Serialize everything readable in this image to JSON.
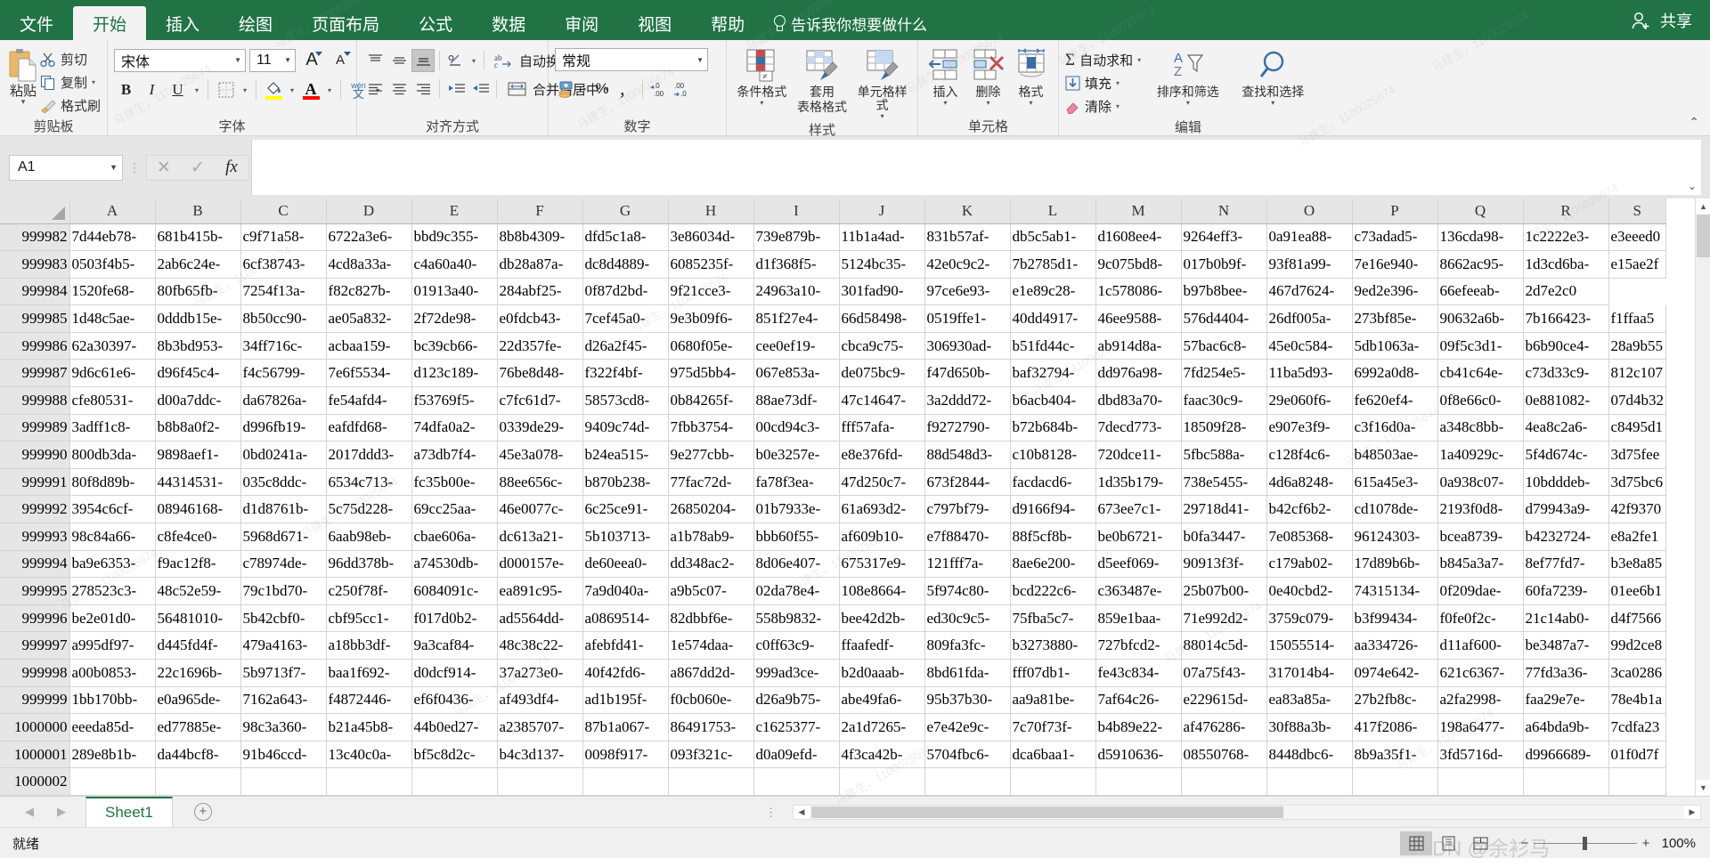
{
  "titlebar": {
    "tabs": [
      {
        "label": "文件",
        "active": false
      },
      {
        "label": "开始",
        "active": true
      },
      {
        "label": "插入",
        "active": false
      },
      {
        "label": "绘图",
        "active": false
      },
      {
        "label": "页面布局",
        "active": false
      },
      {
        "label": "公式",
        "active": false
      },
      {
        "label": "数据",
        "active": false
      },
      {
        "label": "审阅",
        "active": false
      },
      {
        "label": "视图",
        "active": false
      },
      {
        "label": "帮助",
        "active": false
      }
    ],
    "tell_me": "告诉我你想要做什么",
    "share": "共享"
  },
  "ribbon": {
    "clipboard": {
      "group_label": "剪贴板",
      "paste": "粘贴",
      "cut": "剪切",
      "copy": "复制",
      "format_painter": "格式刷"
    },
    "font": {
      "group_label": "字体",
      "font_name": "宋体",
      "font_size": "11",
      "bold": "B",
      "italic": "I",
      "underline": "U",
      "grow_font": "A",
      "shrink_font": "A",
      "phonetic": "wén 文"
    },
    "alignment": {
      "group_label": "对齐方式",
      "wrap_text": "自动换行",
      "merge_center": "合并后居中"
    },
    "number": {
      "group_label": "数字",
      "format": "常规",
      "percent": "%",
      "comma": "，"
    },
    "styles": {
      "group_label": "样式",
      "conditional": "条件格式",
      "table_style_line1": "套用",
      "table_style_line2": "表格格式",
      "cell_style": "单元格样式"
    },
    "cells": {
      "group_label": "单元格",
      "insert": "插入",
      "delete": "删除",
      "format": "格式"
    },
    "editing": {
      "group_label": "编辑",
      "autosum": "自动求和",
      "fill": "填充",
      "clear": "清除",
      "sort_filter": "排序和筛选",
      "find_select": "查找和选择"
    }
  },
  "formula_bar": {
    "name_box": "A1",
    "cancel_icon": "cancel-icon",
    "confirm_icon": "confirm-icon",
    "fx": "fx",
    "value": ""
  },
  "grid": {
    "columns": [
      "A",
      "B",
      "C",
      "D",
      "E",
      "F",
      "G",
      "H",
      "I",
      "J",
      "K",
      "L",
      "M",
      "N",
      "O",
      "P",
      "Q",
      "R",
      "S"
    ],
    "rows": [
      {
        "num": "999982",
        "cells": [
          "7d44eb78-",
          "681b415b-",
          "c9f71a58-",
          "6722a3e6-",
          "bbd9c355-",
          "8b8b4309-",
          "dfd5c1a8-",
          "3e86034d-",
          "739e879b-",
          "11b1a4ad-",
          "831b57af-",
          "db5c5ab1-",
          "d1608ee4-",
          "9264eff3-",
          "0a91ea88-",
          "c73adad5-",
          "136cda98-",
          "1c2222e3-",
          "e3eeed0"
        ]
      },
      {
        "num": "999983",
        "cells": [
          "0503f4b5-",
          "2ab6c24e-",
          "6cf38743-",
          "4cd8a33a-",
          "c4a60a40-",
          "db28a87a-",
          "dc8d4889-",
          "6085235f-",
          "d1f368f5-",
          "5124bc35-",
          "42e0c9c2-",
          "7b2785d1-",
          "9c075bd8-",
          "017b0b9f-",
          "93f81a99-",
          "7e16e940-",
          "8662ac95-",
          "1d3cd6ba-",
          "e15ae2f"
        ]
      },
      {
        "num": "999984",
        "cells": [
          "1520fe68-",
          "80fb65fb-",
          "7254f13a-",
          "f82c827b-",
          "01913a40-",
          "284abf25-",
          "0f87d2bd-",
          "9f21cce3-",
          "24963a10-",
          "301fad90-",
          "97ce6e93-",
          "e1e89c28-",
          "1c578086-",
          "b97b8bee-",
          "467d7624-",
          "9ed2e396-",
          "66efeeab-",
          "2d7e2c0"
        ]
      },
      {
        "num": "999985",
        "cells": [
          "1d48c5ae-",
          "0dddb15e-",
          "8b50cc90-",
          "ae05a832-",
          "2f72de98-",
          "e0fdcb43-",
          "7cef45a0-",
          "9e3b09f6-",
          "851f27e4-",
          "66d58498-",
          "0519ffe1-",
          "40dd4917-",
          "46ee9588-",
          "576d4404-",
          "26df005a-",
          "273bf85e-",
          "90632a6b-",
          "7b166423-",
          "f1ffaa5"
        ]
      },
      {
        "num": "999986",
        "cells": [
          "62a30397-",
          "8b3bd953-",
          "34ff716c-",
          "acbaa159-",
          "bc39cb66-",
          "22d357fe-",
          "d26a2f45-",
          "0680f05e-",
          "cee0ef19-",
          "cbca9c75-",
          "306930ad-",
          "b51fd44c-",
          "ab914d8a-",
          "57bac6c8-",
          "45e0c584-",
          "5db1063a-",
          "09f5c3d1-",
          "b6b90ce4-",
          "28a9b55"
        ]
      },
      {
        "num": "999987",
        "cells": [
          "9d6c61e6-",
          "d96f45c4-",
          "f4c56799-",
          "7e6f5534-",
          "d123c189-",
          "76be8d48-",
          "f322f4bf-",
          "975d5bb4-",
          "067e853a-",
          "de075bc9-",
          "f47d650b-",
          "baf32794-",
          "dd976a98-",
          "7fd254e5-",
          "11ba5d93-",
          "6992a0d8-",
          "cb41c64e-",
          "c73d33c9-",
          "812c107"
        ]
      },
      {
        "num": "999988",
        "cells": [
          "cfe80531-",
          "d00a7ddc-",
          "da67826a-",
          "fe54afd4-",
          "f53769f5-",
          "c7fc61d7-",
          "58573cd8-",
          "0b84265f-",
          "88ae73df-",
          "47c14647-",
          "3a2ddd72-",
          "b6acb404-",
          "dbd83a70-",
          "faac30c9-",
          "29e060f6-",
          "fe620ef4-",
          "0f8e66c0-",
          "0e881082-",
          "07d4b32"
        ]
      },
      {
        "num": "999989",
        "cells": [
          "3adff1c8-",
          "b8b8a0f2-",
          "d996fb19-",
          "eafdfd68-",
          "74dfa0a2-",
          "0339de29-",
          "9409c74d-",
          "7fbb3754-",
          "00cd94c3-",
          "fff57afa-",
          "f9272790-",
          "b72b684b-",
          "7decd773-",
          "18509f28-",
          "e907e3f9-",
          "c3f16d0a-",
          "a348c8bb-",
          "4ea8c2a6-",
          "c8495d1"
        ]
      },
      {
        "num": "999990",
        "cells": [
          "800db3da-",
          "9898aef1-",
          "0bd0241a-",
          "2017ddd3-",
          "a73db7f4-",
          "45e3a078-",
          "b24ea515-",
          "9e277cbb-",
          "b0e3257e-",
          "e8e376fd-",
          "88d548d3-",
          "c10b8128-",
          "720dce11-",
          "5fbc588a-",
          "c128f4c6-",
          "b48503ae-",
          "1a40929c-",
          "5f4d674c-",
          "3d75fee"
        ]
      },
      {
        "num": "999991",
        "cells": [
          "80f8d89b-",
          "44314531-",
          "035c8ddc-",
          "6534c713-",
          "fc35b00e-",
          "88ee656c-",
          "b870b238-",
          "77fac72d-",
          "fa78f3ea-",
          "47d250c7-",
          "673f2844-",
          "facdacd6-",
          "1d35b179-",
          "738e5455-",
          "4d6a8248-",
          "615a45e3-",
          "0a938c07-",
          "10bdddeb-",
          "3d75bc6"
        ]
      },
      {
        "num": "999992",
        "cells": [
          "3954c6cf-",
          "08946168-",
          "d1d8761b-",
          "5c75d228-",
          "69cc25aa-",
          "46e0077c-",
          "6c25ce91-",
          "26850204-",
          "01b7933e-",
          "61a693d2-",
          "c797bf79-",
          "d9166f94-",
          "673ee7c1-",
          "29718d41-",
          "b42cf6b2-",
          "cd1078de-",
          "2193f0d8-",
          "d79943a9-",
          "42f9370"
        ]
      },
      {
        "num": "999993",
        "cells": [
          "98c84a66-",
          "c8fe4ce0-",
          "5968d671-",
          "6aab98eb-",
          "cbae606a-",
          "dc613a21-",
          "5b103713-",
          "a1b78ab9-",
          "bbb60f55-",
          "af609b10-",
          "e7f88470-",
          "88f5cf8b-",
          "be0b6721-",
          "b0fa3447-",
          "7e085368-",
          "96124303-",
          "bcea8739-",
          "b4232724-",
          "e8a2fe1"
        ]
      },
      {
        "num": "999994",
        "cells": [
          "ba9e6353-",
          "f9ac12f8-",
          "c78974de-",
          "96dd378b-",
          "a74530db-",
          "d000157e-",
          "de60eea0-",
          "dd348ac2-",
          "8d06e407-",
          "675317e9-",
          "121fff7a-",
          "8ae6e200-",
          "d5eef069-",
          "90913f3f-",
          "c179ab02-",
          "17d89b6b-",
          "b845a3a7-",
          "8ef77fd7-",
          "b3e8a85"
        ]
      },
      {
        "num": "999995",
        "cells": [
          "278523c3-",
          "48c52e59-",
          "79c1bd70-",
          "c250f78f-",
          "6084091c-",
          "ea891c95-",
          "7a9d040a-",
          "a9b5c07-",
          "02da78e4-",
          "108e8664-",
          "5f974c80-",
          "bcd222c6-",
          "c363487e-",
          "25b07b00-",
          "0e40cbd2-",
          "74315134-",
          "0f209dae-",
          "60fa7239-",
          "01ee6b1"
        ]
      },
      {
        "num": "999996",
        "cells": [
          "be2e01d0-",
          "56481010-",
          "5b42cbf0-",
          "cbf95cc1-",
          "f017d0b2-",
          "ad5564dd-",
          "a0869514-",
          "82dbbf6e-",
          "558b9832-",
          "bee42d2b-",
          "ed30c9c5-",
          "75fba5c7-",
          "859e1baa-",
          "71e992d2-",
          "3759c079-",
          "b3f99434-",
          "f0fe0f2c-",
          "21c14ab0-",
          "d4f7566"
        ]
      },
      {
        "num": "999997",
        "cells": [
          "a995df97-",
          "d445fd4f-",
          "479a4163-",
          "a18bb3df-",
          "9a3caf84-",
          "48c38c22-",
          "afebfd41-",
          "1e574daa-",
          "c0ff63c9-",
          "ffaafedf-",
          "809fa3fc-",
          "b3273880-",
          "727bfcd2-",
          "88014c5d-",
          "15055514-",
          "aa334726-",
          "d11af600-",
          "be3487a7-",
          "99d2ce8"
        ]
      },
      {
        "num": "999998",
        "cells": [
          "a00b0853-",
          "22c1696b-",
          "5b9713f7-",
          "baa1f692-",
          "d0dcf914-",
          "37a273e0-",
          "40f42fd6-",
          "a867dd2d-",
          "999ad3ce-",
          "b2d0aaab-",
          "8bd61fda-",
          "fff07db1-",
          "fe43c834-",
          "07a75f43-",
          "317014b4-",
          "0974e642-",
          "621c6367-",
          "77fd3a36-",
          "3ca0286"
        ]
      },
      {
        "num": "999999",
        "cells": [
          "1bb170bb-",
          "e0a965de-",
          "7162a643-",
          "f4872446-",
          "ef6f0436-",
          "af493df4-",
          "ad1b195f-",
          "f0cb060e-",
          "d26a9b75-",
          "abe49fa6-",
          "95b37b30-",
          "aa9a81be-",
          "7af64c26-",
          "e229615d-",
          "ea83a85a-",
          "27b2fb8c-",
          "a2fa2998-",
          "faa29e7e-",
          "78e4b1a"
        ]
      },
      {
        "num": "1000000",
        "cells": [
          "eeeda85d-",
          "ed77885e-",
          "98c3a360-",
          "b21a45b8-",
          "44b0ed27-",
          "a2385707-",
          "87b1a067-",
          "86491753-",
          "c1625377-",
          "2a1d7265-",
          "e7e42e9c-",
          "7c70f73f-",
          "b4b89e22-",
          "af476286-",
          "30f88a3b-",
          "417f2086-",
          "198a6477-",
          "a64bda9b-",
          "7cdfa23"
        ]
      },
      {
        "num": "1000001",
        "cells": [
          "289e8b1b-",
          "da44bcf8-",
          "91b46ccd-",
          "13c40c0a-",
          "bf5c8d2c-",
          "b4c3d137-",
          "0098f917-",
          "093f321c-",
          "d0a09efd-",
          "4f3ca42b-",
          "5704fbc6-",
          "dca6baa1-",
          "d5910636-",
          "08550768-",
          "8448dbc6-",
          "8b9a35f1-",
          "3fd5716d-",
          "d9966689-",
          "01f0d7f"
        ]
      },
      {
        "num": "1000002",
        "cells": [
          "",
          "",
          "",
          "",
          "",
          "",
          "",
          "",
          "",
          "",
          "",
          "",
          "",
          "",
          "",
          "",
          "",
          "",
          ""
        ]
      }
    ]
  },
  "sheetbar": {
    "sheet_name": "Sheet1",
    "add_sheet_icon": "plus-icon"
  },
  "statusbar": {
    "status": "就绪",
    "zoom": "100%",
    "views": [
      "normal-view-icon",
      "page-layout-icon",
      "page-break-icon"
    ],
    "watermark": "CSDN @余衫马"
  },
  "colors": {
    "accent": "#217346",
    "ribbon_bg": "#f3f3f3",
    "grid_header_bg": "#e6e6e6"
  }
}
